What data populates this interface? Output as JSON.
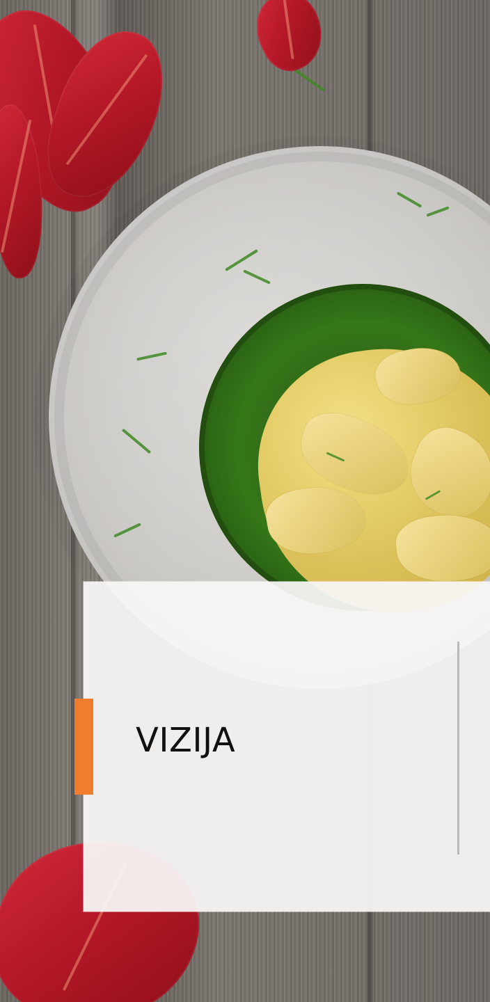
{
  "title": "VIZIJA",
  "colors": {
    "accent": "#ef7d2d",
    "card_background": "#f8f7f5",
    "text": "#111111"
  }
}
